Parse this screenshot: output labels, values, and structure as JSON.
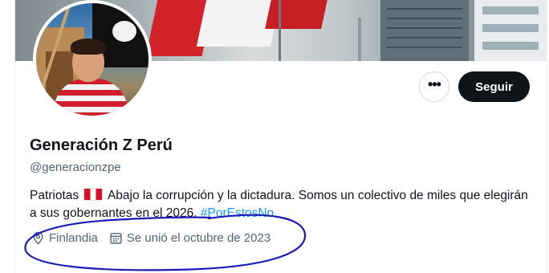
{
  "profile": {
    "display_name": "Generación Z Perú",
    "handle": "@generacionzpe",
    "bio_part1": "Patriotas",
    "bio_part2": "Abajo la corrupción y la dictadura. Somos un colectivo de miles que elegirán a sus gobernantes en el 2026.",
    "bio_hashtag": "#PorEstosNo",
    "location": "Finlandia",
    "joined": "Se unió el octubre de 2023"
  },
  "actions": {
    "more_label": "•••",
    "follow_label": "Seguir"
  },
  "icons": {
    "more": "more-options-icon",
    "location": "location-pin-icon",
    "calendar": "calendar-icon",
    "flag": "peru-flag-emoji"
  },
  "colors": {
    "link": "#1d9bf0",
    "secondary_text": "#536471",
    "follow_bg": "#0f1419",
    "annotation": "#1a1ab8"
  }
}
